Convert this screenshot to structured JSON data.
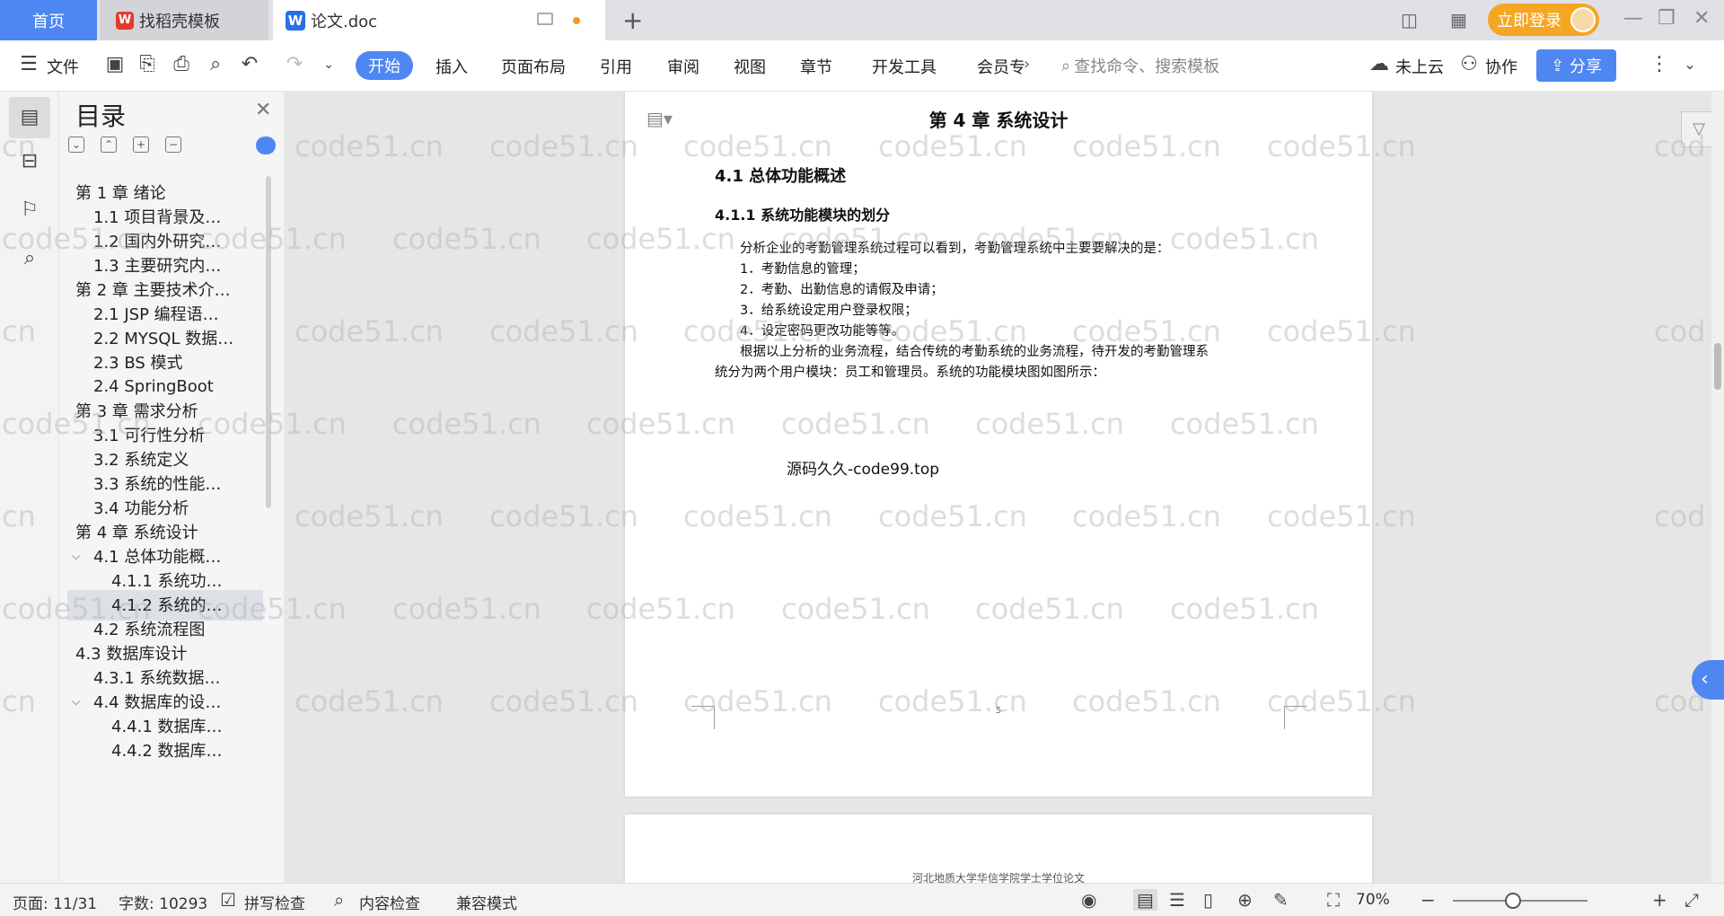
{
  "tabs": {
    "home": "首页",
    "template": "找稻壳模板",
    "document": "论文.doc",
    "template_logo": "W",
    "document_logo": "W"
  },
  "titlebar": {
    "login": "立即登录"
  },
  "ribbon": {
    "file": "文件",
    "tabs": [
      "开始",
      "插入",
      "页面布局",
      "引用",
      "审阅",
      "视图",
      "章节",
      "开发工具",
      "会员专"
    ],
    "search_placeholder": "查找命令、搜索模板",
    "cloud": "未上云",
    "collab": "协作",
    "share": "分享"
  },
  "toc": {
    "title": "目录",
    "items": [
      {
        "label": "第 1 章  绪论",
        "level": 0,
        "chev": true
      },
      {
        "label": "1.1  项目背景及…",
        "level": 1
      },
      {
        "label": "1.2  国内外研究…",
        "level": 1
      },
      {
        "label": "1.3  主要研究内…",
        "level": 1
      },
      {
        "label": "第 2 章  主要技术介…",
        "level": 0,
        "chev": true
      },
      {
        "label": "2.1 JSP  编程语…",
        "level": 1
      },
      {
        "label": "2.2 MYSQL 数据…",
        "level": 1
      },
      {
        "label": "2.3 BS 模式",
        "level": 1
      },
      {
        "label": "2.4 SpringBoot",
        "level": 1
      },
      {
        "label": "第 3 章  需求分析",
        "level": 0,
        "chev": true
      },
      {
        "label": "3.1  可行性分析",
        "level": 1
      },
      {
        "label": "3.2  系统定义",
        "level": 1
      },
      {
        "label": "3.3  系统的性能…",
        "level": 1
      },
      {
        "label": "3.4  功能分析",
        "level": 1
      },
      {
        "label": "第 4 章  系统设计",
        "level": 0,
        "chev": true,
        "selected": true
      },
      {
        "label": "4.1  总体功能概…",
        "level": 1,
        "chev": true
      },
      {
        "label": "4.1.1 系统功…",
        "level": 2
      },
      {
        "label": "4.1.2  系统的…",
        "level": 2
      },
      {
        "label": "4.2  系统流程图",
        "level": 1
      },
      {
        "label": "4.3 数据库设计",
        "level": 0,
        "chev": true
      },
      {
        "label": "4.3.1  系统数据…",
        "level": 1
      },
      {
        "label": "4.4  数据库的设…",
        "level": 1,
        "chev": true
      },
      {
        "label": "4.4.1  数据库…",
        "level": 2
      },
      {
        "label": "4.4.2  数据库…",
        "level": 2
      }
    ]
  },
  "document": {
    "chapter_title": "第 4 章  系统设计",
    "section_title": "4.1  总体功能概述",
    "subsection_title": "4.1.1 系统功能模块的划分",
    "paragraphs": [
      "分析企业的考勤管理系统过程可以看到，考勤管理系统中主要要解决的是：",
      "1．考勤信息的管理；",
      "2．考勤、出勤信息的请假及申请；",
      "3．给系统设定用户登录权限；",
      "4．设定密码更改功能等等。",
      "根据以上分析的业务流程，结合传统的考勤系统的业务流程，待开发的考勤管理系",
      "统分为两个用户模块：员工和管理员。系统的功能模块图如图所示："
    ],
    "source_line": "源码久久-code99.top",
    "page_number": "5",
    "next_page_header": "河北地质大学华信学院学士学位论文"
  },
  "watermark": "code51.cn",
  "watermark_partial": [
    "cn",
    "cod"
  ],
  "statusbar": {
    "page": "页面: 11/31",
    "words": "字数: 10293",
    "spellcheck": "拼写检查",
    "content_check": "内容检查",
    "compat": "兼容模式",
    "zoom": "70%"
  }
}
